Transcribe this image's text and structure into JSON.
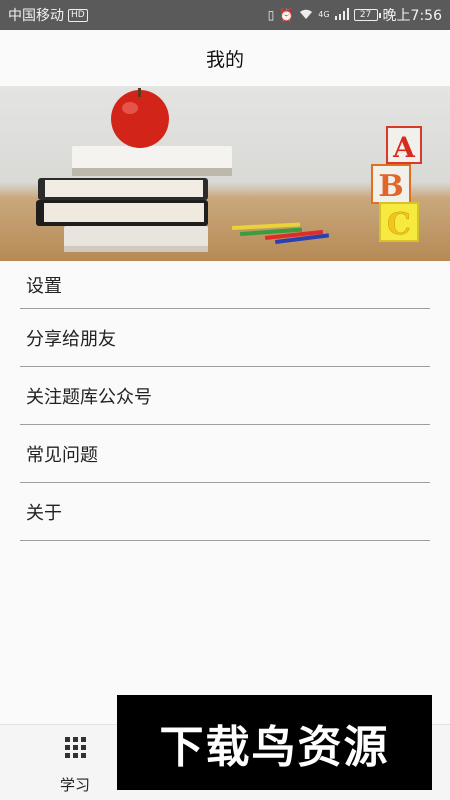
{
  "status_bar": {
    "carrier": "中国移动",
    "hd_badge": "HD",
    "network": "4G",
    "battery": "27",
    "time": "晚上7:56"
  },
  "header": {
    "title": "我的"
  },
  "banner": {
    "blocks": [
      "A",
      "B",
      "C"
    ]
  },
  "menu": {
    "items": [
      {
        "label": "设置"
      },
      {
        "label": "分享给朋友"
      },
      {
        "label": "关注题库公众号"
      },
      {
        "label": "常见问题"
      },
      {
        "label": "关于"
      }
    ]
  },
  "bottom_nav": {
    "items": [
      {
        "label": "学习",
        "icon": "grid-icon"
      }
    ]
  },
  "watermark": {
    "text": "下载鸟资源"
  }
}
